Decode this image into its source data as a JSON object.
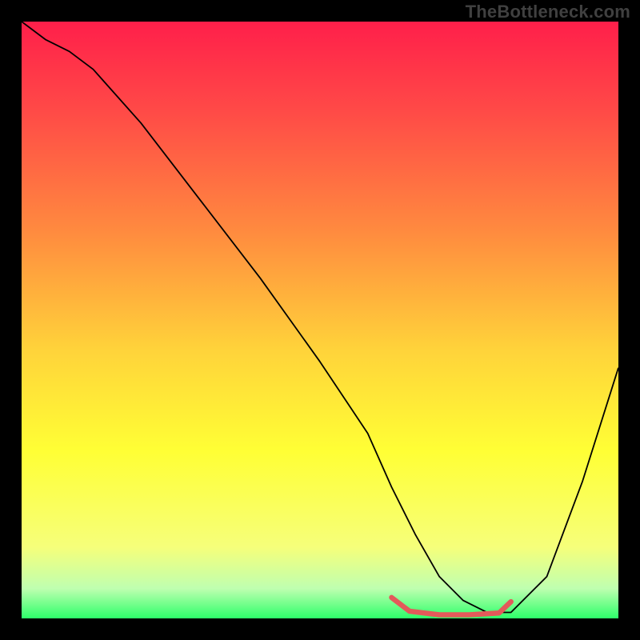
{
  "watermark": "TheBottleneck.com",
  "chart_data": {
    "type": "line",
    "title": "",
    "xlabel": "",
    "ylabel": "",
    "xlim": [
      0,
      100
    ],
    "ylim": [
      0,
      100
    ],
    "grid": false,
    "gradient_stops": [
      {
        "offset": 0,
        "color": "#ff1f4a"
      },
      {
        "offset": 15,
        "color": "#ff4a47"
      },
      {
        "offset": 35,
        "color": "#ff8a3f"
      },
      {
        "offset": 55,
        "color": "#ffd33a"
      },
      {
        "offset": 72,
        "color": "#ffff35"
      },
      {
        "offset": 88,
        "color": "#f6ff7a"
      },
      {
        "offset": 95,
        "color": "#bfffb0"
      },
      {
        "offset": 100,
        "color": "#2dff6a"
      }
    ],
    "series": [
      {
        "name": "bottleneck-curve",
        "stroke": "#000000",
        "stroke_width": 1.8,
        "x": [
          0,
          4,
          8,
          12,
          20,
          30,
          40,
          50,
          58,
          62,
          66,
          70,
          74,
          78,
          82,
          88,
          94,
          100
        ],
        "y": [
          100,
          97,
          95,
          92,
          83,
          70,
          57,
          43,
          31,
          22,
          14,
          7,
          3,
          1,
          1,
          7,
          23,
          42
        ]
      }
    ],
    "highlight": {
      "name": "ideal-range",
      "stroke": "#e35a5a",
      "stroke_width": 6.5,
      "linecap": "round",
      "points": [
        {
          "x": 62,
          "y": 3.5
        },
        {
          "x": 65,
          "y": 1.2
        },
        {
          "x": 70,
          "y": 0.6
        },
        {
          "x": 75,
          "y": 0.6
        },
        {
          "x": 80,
          "y": 0.9
        },
        {
          "x": 82,
          "y": 2.8
        }
      ]
    }
  }
}
